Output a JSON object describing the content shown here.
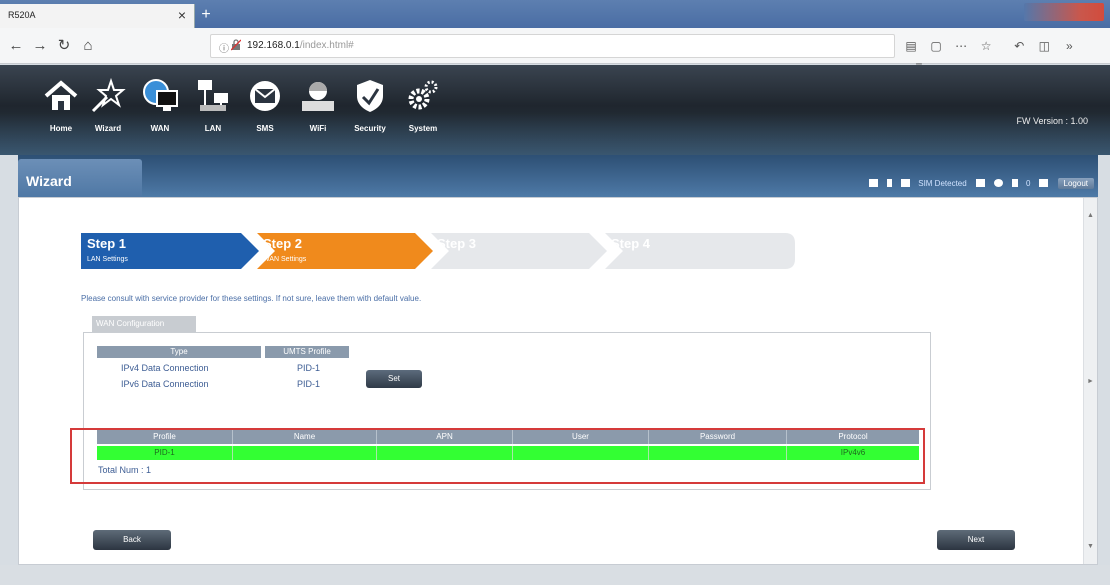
{
  "browser": {
    "tab_title": "R520A",
    "tab_close": "×",
    "new_tab": "+",
    "url_host": "192.168.0.1",
    "url_path": "/index.html#",
    "icons": [
      "back-arrow-icon",
      "forward-arrow-icon",
      "reload-icon",
      "home-icon",
      "library-icon",
      "reader-icon",
      "more-icon",
      "bookmark-star-icon",
      "undo-icon",
      "tabs-icon",
      "overflow-icon",
      "menu-icon"
    ]
  },
  "router": {
    "menu": [
      {
        "label": "Home",
        "icon": "home-icon"
      },
      {
        "label": "Wizard",
        "icon": "wizard-icon"
      },
      {
        "label": "WAN",
        "icon": "wan-icon"
      },
      {
        "label": "LAN",
        "icon": "lan-icon"
      },
      {
        "label": "SMS",
        "icon": "sms-icon"
      },
      {
        "label": "WiFi",
        "icon": "wifi-icon"
      },
      {
        "label": "Security",
        "icon": "security-icon"
      },
      {
        "label": "System",
        "icon": "system-icon"
      }
    ],
    "fw_version": "FW Version : 1.00"
  },
  "header": {
    "title": "Wizard",
    "sim_status": "SIM Detected",
    "sms_count": "0",
    "logout": "Logout"
  },
  "wizard": {
    "steps": [
      {
        "title": "Step 1",
        "sub": "LAN Settings",
        "state": "done",
        "color": "#1f5fae"
      },
      {
        "title": "Step 2",
        "sub": "WAN Settings",
        "state": "active",
        "color": "#f08a1c"
      },
      {
        "title": "Step 3",
        "sub": "",
        "state": "pending",
        "color": "#e3e5e8"
      },
      {
        "title": "Step 4",
        "sub": "",
        "state": "pending",
        "color": "#e3e5e8"
      }
    ],
    "hint": "Please consult with service provider for these settings. If not sure, leave them with default value.",
    "config_label": "WAN Configuration",
    "profile_table": {
      "headers": [
        "Type",
        "UMTS Profile"
      ],
      "rows": [
        [
          "IPv4 Data Connection",
          "PID-1"
        ],
        [
          "IPv6 Data Connection",
          "PID-1"
        ]
      ]
    },
    "set_button": "Set",
    "grid": {
      "headers": [
        "Profile",
        "Name",
        "APN",
        "User",
        "Password",
        "Protocol"
      ],
      "rows": [
        [
          "PID-1",
          "",
          "",
          "",
          "",
          "IPv4v6"
        ]
      ],
      "selected_color": "#33ff33"
    },
    "total": "Total Num : 1",
    "back": "Back",
    "next": "Next"
  }
}
